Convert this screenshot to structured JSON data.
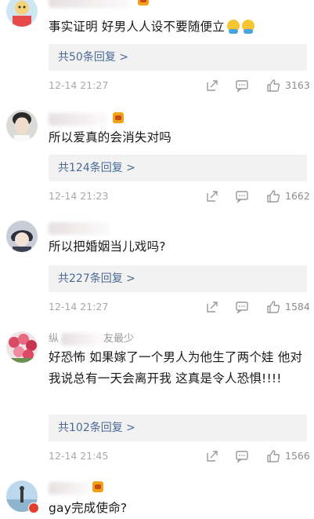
{
  "comments": [
    {
      "username": "",
      "text": "事实证明 好男人人设不要随便立",
      "reply_link": "共50条回复 >",
      "time": "12-14 21:27",
      "likes": "3163",
      "has_emoji": true
    },
    {
      "username": "",
      "text": "所以爱真的会消失对吗",
      "reply_link": "共124条回复 >",
      "time": "12-14 21:23",
      "likes": "1662"
    },
    {
      "username": "",
      "text": "所以把婚姻当儿戏吗?",
      "reply_link": "共227条回复 >",
      "time": "12-14 21:27",
      "likes": "1584"
    },
    {
      "username": "纵",
      "username_suffix": "友最少",
      "text": "好恐怖 如果嫁了一个男人为他生了两个娃 他对我说总有一天会离开我 这真是令人恐惧!!!!",
      "reply_link": "共102条回复 >",
      "time": "12-14 21:45",
      "likes": "1566"
    },
    {
      "username": "",
      "text": "gay完成使命?"
    }
  ],
  "colors": {
    "link": "#4a6a95",
    "meta": "#a8a8a8",
    "reply_bg": "#f2f2f2",
    "badge": "#e0412e"
  },
  "icons": [
    "share-icon",
    "comment-icon",
    "like-icon",
    "emoji-icon",
    "level-icon"
  ]
}
